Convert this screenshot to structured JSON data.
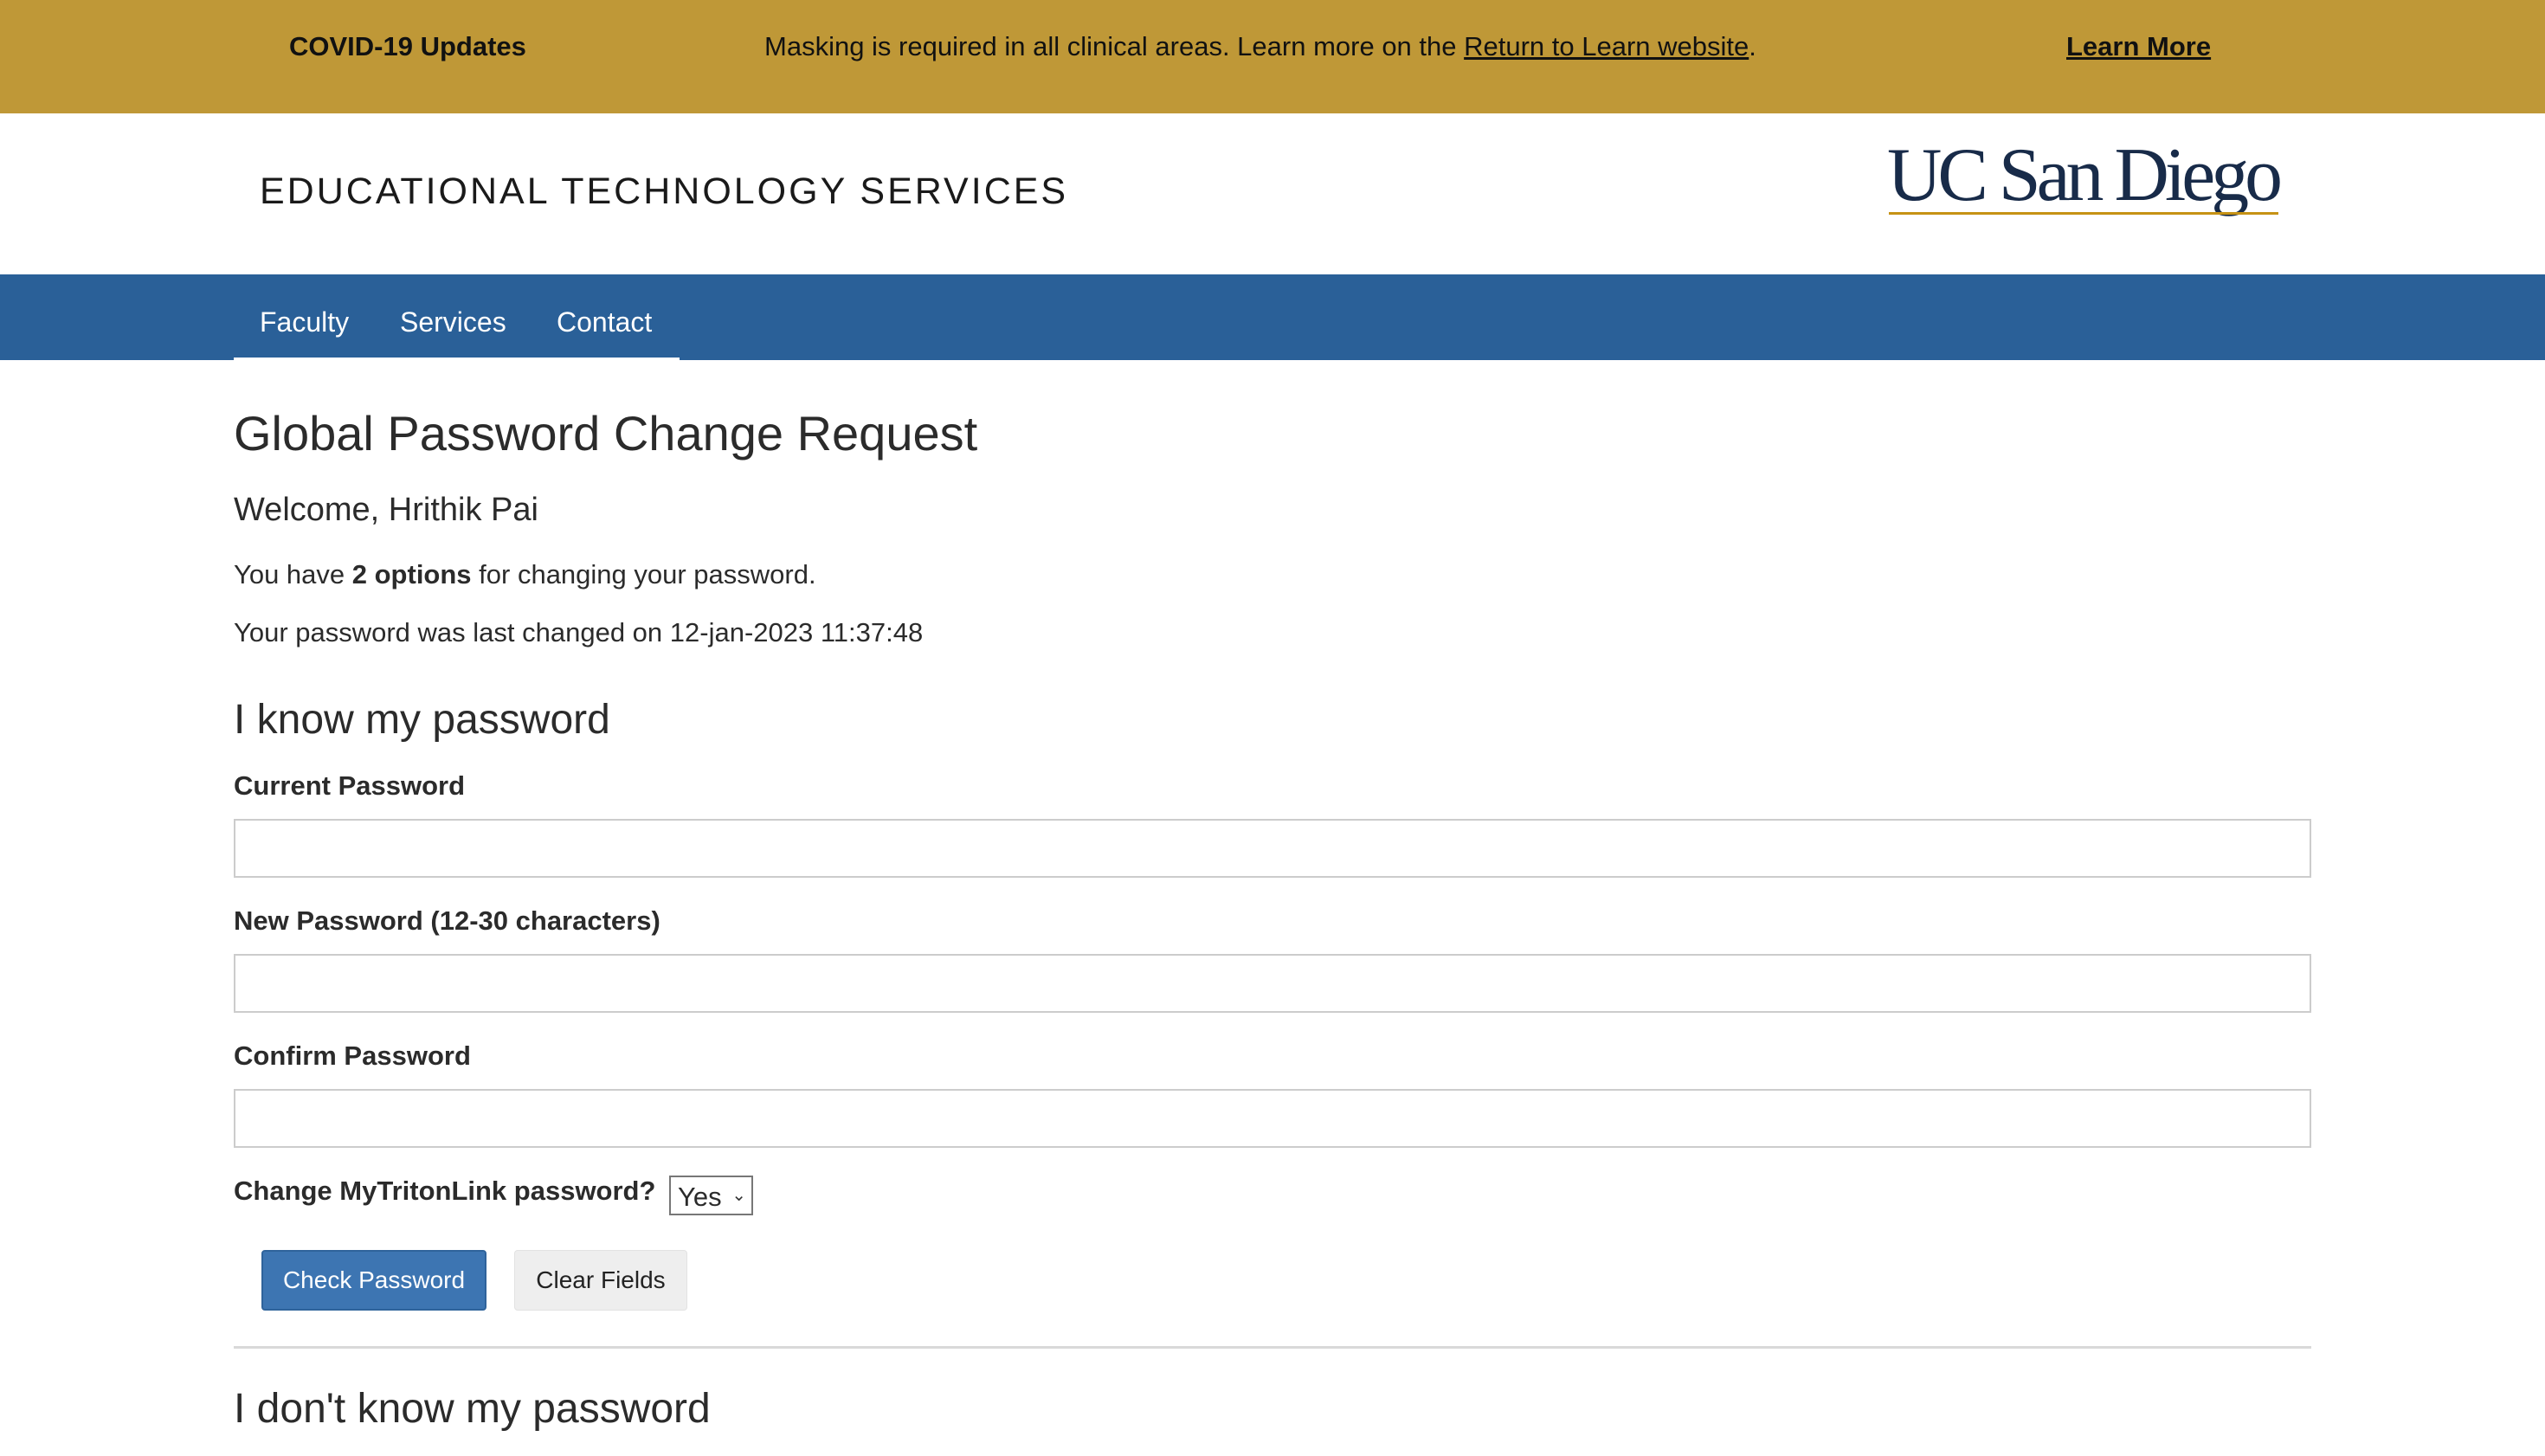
{
  "alert": {
    "title": "COVID-19 Updates",
    "message_prefix": "Masking is required in all clinical areas. Learn more on the ",
    "message_link": "Return to Learn website",
    "message_suffix": ".",
    "cta": "Learn More",
    "background": "#bf9837"
  },
  "header": {
    "site_title": "EDUCATIONAL TECHNOLOGY SERVICES",
    "logo_text": "UC San Diego",
    "logo_color": "#182b49",
    "logo_underline_color": "#c69214"
  },
  "nav": {
    "background": "#2a6098",
    "items": [
      {
        "label": "Faculty"
      },
      {
        "label": "Services"
      },
      {
        "label": "Contact"
      }
    ]
  },
  "page": {
    "title": "Global Password Change Request",
    "welcome": "Welcome, Hrithik Pai",
    "options_prefix": "You have ",
    "options_bold": "2 options",
    "options_suffix": " for changing your password.",
    "last_changed": "Your password was last changed on 12-jan-2023 11:37:48"
  },
  "form": {
    "heading": "I know my password",
    "current_password_label": "Current Password",
    "current_password_value": "",
    "new_password_label": "New Password (12-30 characters)",
    "new_password_value": "",
    "confirm_password_label": "Confirm Password",
    "confirm_password_value": "",
    "mytritonlink_label": "Change MyTritonLink password?",
    "mytritonlink_value": "Yes",
    "check_button": "Check Password",
    "clear_button": "Clear Fields"
  },
  "section2": {
    "heading": "I don't know my password"
  }
}
